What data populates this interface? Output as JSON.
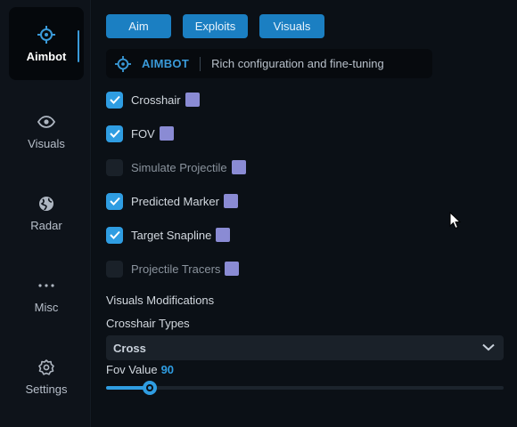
{
  "sidebar": {
    "items": [
      {
        "label": "Aimbot",
        "icon": "crosshair-icon",
        "active": true
      },
      {
        "label": "Visuals",
        "icon": "eye-icon",
        "active": false
      },
      {
        "label": "Radar",
        "icon": "globe-icon",
        "active": false
      },
      {
        "label": "Misc",
        "icon": "dots-icon",
        "active": false
      },
      {
        "label": "Settings",
        "icon": "gear-icon",
        "active": false
      }
    ]
  },
  "tabs": [
    {
      "label": "Aim"
    },
    {
      "label": "Exploits"
    },
    {
      "label": "Visuals"
    }
  ],
  "section": {
    "icon": "crosshair-icon",
    "title": "AIMBOT",
    "description": "Rich configuration and fine-tuning"
  },
  "options": [
    {
      "label": "Crosshair",
      "checked": true,
      "enabled": true,
      "swatch_color": "#8a8bd4"
    },
    {
      "label": "FOV",
      "checked": true,
      "enabled": true,
      "swatch_color": "#8a8bd4"
    },
    {
      "label": "Simulate Projectile",
      "checked": false,
      "enabled": false,
      "swatch_color": "#8a8bd4"
    },
    {
      "label": "Predicted Marker",
      "checked": true,
      "enabled": true,
      "swatch_color": "#8a8bd4"
    },
    {
      "label": "Target Snapline",
      "checked": true,
      "enabled": true,
      "swatch_color": "#8a8bd4"
    },
    {
      "label": "Projectile Tracers",
      "checked": false,
      "enabled": false,
      "swatch_color": "#8a8bd4"
    }
  ],
  "visuals_modifications": {
    "heading": "Visuals Modifications",
    "crosshair_types_label": "Crosshair Types",
    "crosshair_type_value": "Cross",
    "fov_label": "Fov Value",
    "fov_value": "90",
    "fov_fraction": 0.11
  },
  "colors": {
    "accent": "#2f9de2",
    "tab_bg": "#1b7fc2",
    "swatch": "#8a8bd4"
  }
}
